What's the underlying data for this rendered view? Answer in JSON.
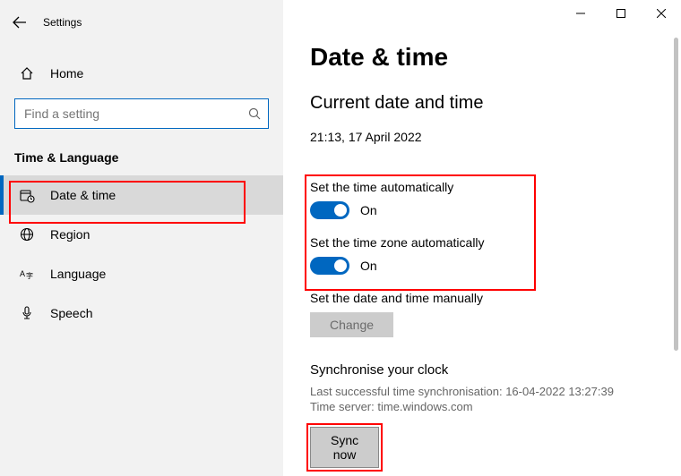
{
  "window": {
    "app_title": "Settings"
  },
  "sidebar": {
    "home": "Home",
    "search_placeholder": "Find a setting",
    "group": "Time & Language",
    "items": [
      {
        "label": "Date & time"
      },
      {
        "label": "Region"
      },
      {
        "label": "Language"
      },
      {
        "label": "Speech"
      }
    ]
  },
  "page": {
    "title": "Date & time",
    "section_current": "Current date and time",
    "now": "21:13, 17 April 2022",
    "auto_time_label": "Set the time automatically",
    "auto_time_state": "On",
    "auto_tz_label": "Set the time zone automatically",
    "auto_tz_state": "On",
    "manual_label": "Set the date and time manually",
    "change_btn": "Change",
    "sync_heading": "Synchronise your clock",
    "sync_last": "Last successful time synchronisation: 16-04-2022 13:27:39",
    "sync_server": "Time server: time.windows.com",
    "sync_btn": "Sync now"
  }
}
